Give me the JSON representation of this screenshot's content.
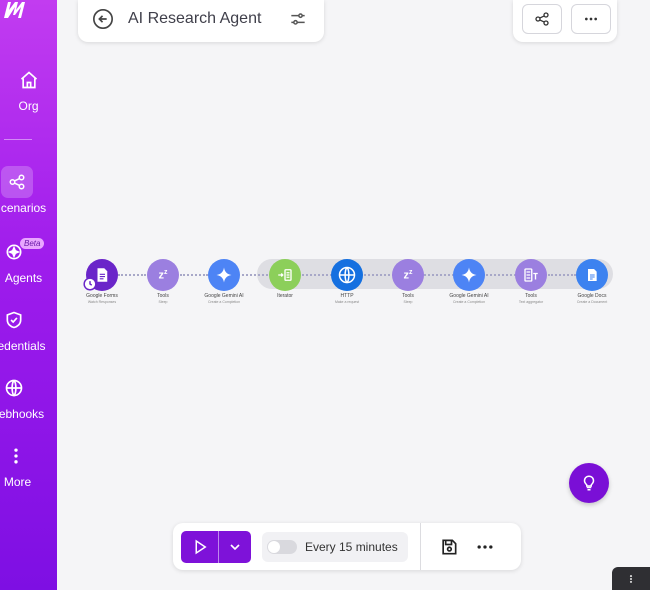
{
  "sidebar": {
    "items": [
      {
        "label": "Org",
        "icon": "home-icon"
      },
      {
        "label": "cenarios",
        "icon": "share-nodes-icon",
        "active": true
      },
      {
        "label": "Agents",
        "icon": "agents-icon",
        "badge": "Beta"
      },
      {
        "label": "edentials",
        "icon": "shield-check-icon"
      },
      {
        "label": "ebhooks",
        "icon": "globe-icon"
      },
      {
        "label": "More",
        "icon": "more-vertical-icon"
      }
    ]
  },
  "header": {
    "title": "AI Research Agent"
  },
  "flow": {
    "nodes": [
      {
        "label": "Google Forms",
        "sub": "Watch Responses",
        "color": "#6a25c9",
        "icon": "google-forms-icon"
      },
      {
        "label": "Tools",
        "sub": "Sleep",
        "color": "#9b7fe0",
        "icon": "sleep-icon"
      },
      {
        "label": "Google Gemini AI",
        "sub": "Create a Completion",
        "color": "#4d84f5",
        "icon": "gemini-icon"
      },
      {
        "label": "Iterator",
        "sub": "",
        "color": "#8ccf5a",
        "icon": "iterator-icon"
      },
      {
        "label": "HTTP",
        "sub": "Make a request",
        "color": "#1570e0",
        "icon": "http-globe-icon"
      },
      {
        "label": "Tools",
        "sub": "Sleep",
        "color": "#9b7fe0",
        "icon": "sleep-icon"
      },
      {
        "label": "Google Gemini AI",
        "sub": "Create a Completion",
        "color": "#4d84f5",
        "icon": "gemini-icon"
      },
      {
        "label": "Tools",
        "sub": "Text aggregator",
        "color": "#9b7fe0",
        "icon": "text-aggregator-icon"
      },
      {
        "label": "Google Docs",
        "sub": "Create a Document",
        "color": "#3c82f0",
        "icon": "google-docs-icon"
      }
    ]
  },
  "toolbar": {
    "schedule_label": "Every 15 minutes"
  },
  "colors": {
    "accent": "#7e12d9",
    "sidebar_top": "#c23cf0",
    "sidebar_bottom": "#7e0fe3"
  }
}
